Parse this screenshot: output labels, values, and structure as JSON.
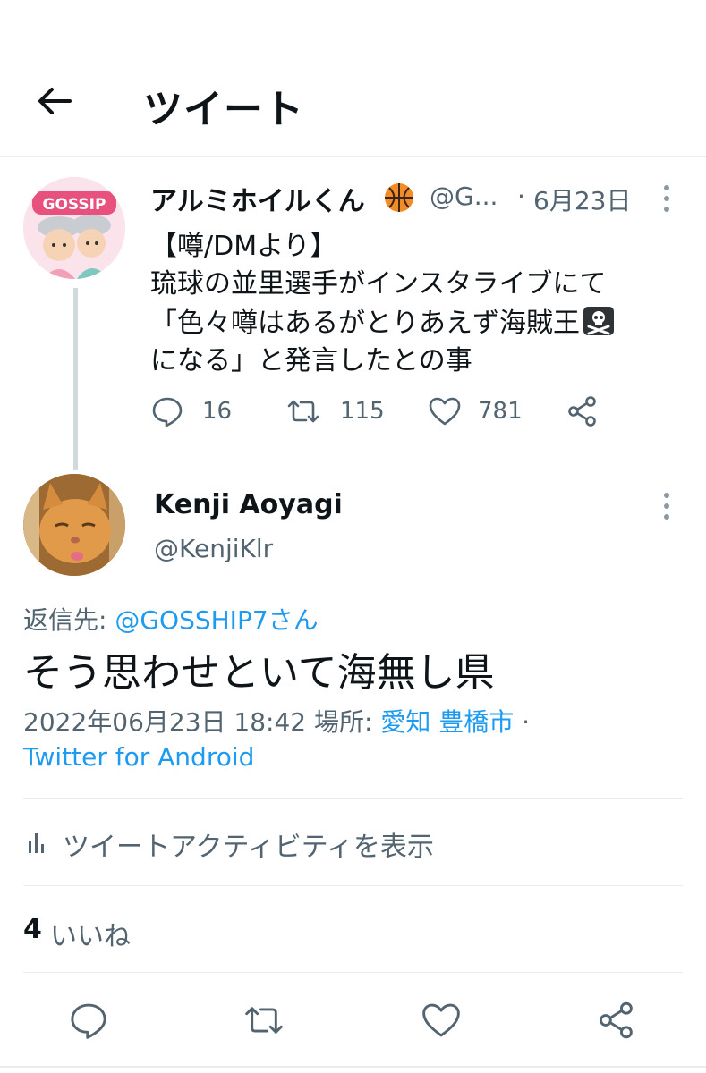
{
  "header": {
    "title": "ツイート",
    "back_icon": "arrow-left-icon"
  },
  "original_tweet": {
    "avatar_text": "GOSSIP",
    "display_name": "アルミホイルくん",
    "badge_icon": "basketball-icon",
    "handle": "@G...",
    "dot": "·",
    "date": "6月23日",
    "lines": [
      "【噂/DMより】",
      "琉球の並里選手がインスタライブにて",
      "「色々噂はあるがとりあえず海賊王",
      "になる」と発言したとの事"
    ],
    "line3_emoji": "skull-crossbones-icon",
    "replies": "16",
    "retweets": "115",
    "likes": "781"
  },
  "reply_tweet": {
    "display_name": "Kenji Aoyagi",
    "handle": "@KenjiKlr",
    "replying_prefix": "返信先: ",
    "replying_user": "@GOSSHIP7さん",
    "text": "そう思わせといて海無し県",
    "timestamp": "2022年06月23日 18:42",
    "location_prefix": " 場所: ",
    "location": "愛知 豊橋市",
    "meta_sep": " ·",
    "client": "Twitter for Android"
  },
  "activity": {
    "label": "ツイートアクティビティを表示",
    "icon": "bar-chart-icon"
  },
  "likes": {
    "count": "4",
    "label": "いいね"
  },
  "colors": {
    "link": "#1d9bf0",
    "muted": "#536471",
    "text": "#0f1419",
    "divider": "#e6ecf0"
  }
}
